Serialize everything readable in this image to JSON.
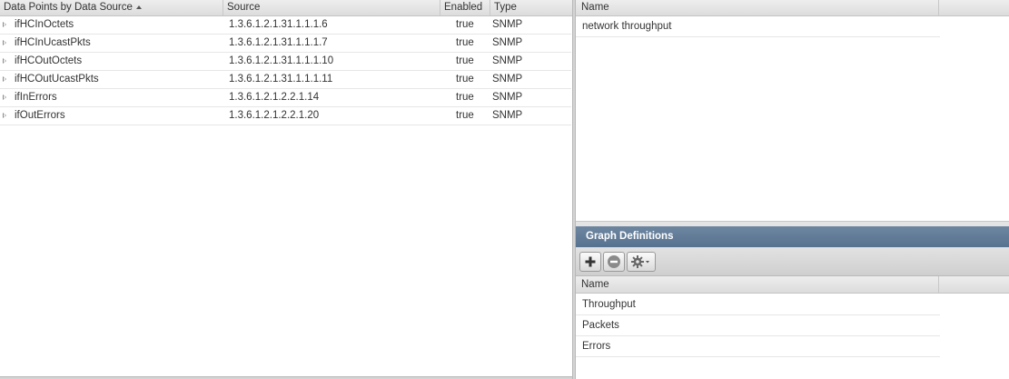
{
  "datapoints_grid": {
    "columns": {
      "name": "Data Points by Data Source",
      "source": "Source",
      "enabled": "Enabled",
      "type": "Type"
    },
    "sort_icon": "sort-ascending-icon",
    "expander_icon": "triangle-right-icon",
    "rows": [
      {
        "name": "ifHCInOctets",
        "source": "1.3.6.1.2.1.31.1.1.1.6",
        "enabled": "true",
        "type": "SNMP"
      },
      {
        "name": "ifHCInUcastPkts",
        "source": "1.3.6.1.2.1.31.1.1.1.7",
        "enabled": "true",
        "type": "SNMP"
      },
      {
        "name": "ifHCOutOctets",
        "source": "1.3.6.1.2.1.31.1.1.1.10",
        "enabled": "true",
        "type": "SNMP"
      },
      {
        "name": "ifHCOutUcastPkts",
        "source": "1.3.6.1.2.1.31.1.1.1.11",
        "enabled": "true",
        "type": "SNMP"
      },
      {
        "name": "ifInErrors",
        "source": "1.3.6.1.2.1.2.2.1.14",
        "enabled": "true",
        "type": "SNMP"
      },
      {
        "name": "ifOutErrors",
        "source": "1.3.6.1.2.1.2.2.1.20",
        "enabled": "true",
        "type": "SNMP"
      }
    ]
  },
  "template_grid": {
    "column": "Name",
    "rows": [
      "network throughput"
    ]
  },
  "graph_definitions": {
    "title": "Graph Definitions",
    "toolbar": {
      "add_icon": "plus-icon",
      "delete_icon": "minus-icon",
      "actions_icon": "gear-icon"
    },
    "column": "Name",
    "rows": [
      "Throughput",
      "Packets",
      "Errors"
    ]
  },
  "colors": {
    "panel_header": "#577290",
    "grid_header": "#dcdcdc"
  }
}
